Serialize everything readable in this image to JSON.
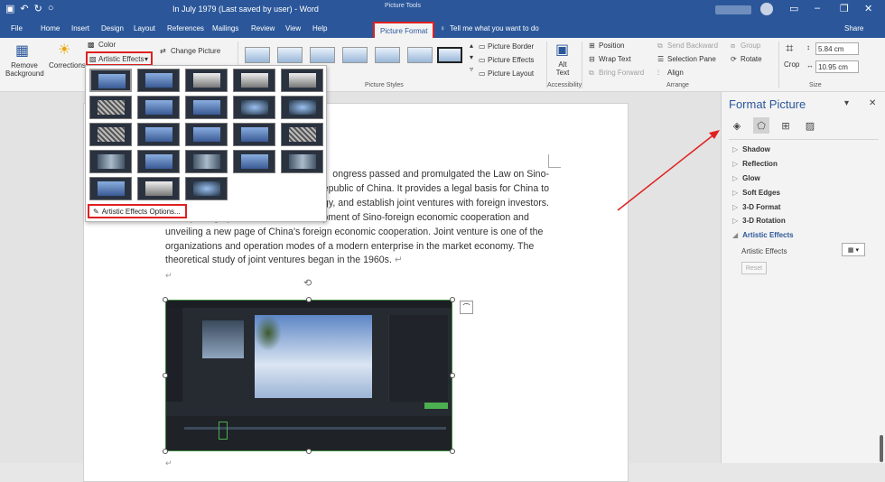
{
  "titlebar": {
    "title": "In July 1979 (Last saved by user)  -  Word",
    "contextual_tab_group": "Picture Tools",
    "icons": [
      "save-icon",
      "undo-icon",
      "redo-icon",
      "autosave-icon",
      "avatar",
      "ribbon-display-icon",
      "minimize-icon",
      "restore-icon",
      "close-icon"
    ]
  },
  "tabs": {
    "items": [
      "File",
      "Home",
      "Insert",
      "Design",
      "Layout",
      "References",
      "Mailings",
      "Review",
      "View",
      "Help"
    ],
    "active": "Picture Format",
    "tell_me": "Tell me what you want to do",
    "share": "Share"
  },
  "ribbon": {
    "adjust": {
      "remove_background": "Remove Background",
      "corrections": "Corrections",
      "color": "Color",
      "artistic_effects": "Artistic Effects",
      "change_picture": "Change Picture"
    },
    "picture_styles": {
      "label": "Picture Styles",
      "border": "Picture Border",
      "effects": "Picture Effects",
      "layout": "Picture Layout"
    },
    "accessibility": {
      "alt_text": "Alt Text",
      "label": "Accessibility"
    },
    "arrange": {
      "position": "Position",
      "wrap_text": "Wrap Text",
      "bring_forward": "Bring Forward",
      "send_backward": "Send Backward",
      "selection_pane": "Selection Pane",
      "align": "Align",
      "group": "Group",
      "rotate": "Rotate",
      "label": "Arrange"
    },
    "size": {
      "crop": "Crop",
      "height": "5.84 cm",
      "width": "10.95 cm",
      "label": "Size"
    }
  },
  "artistic_effects_menu": {
    "option": "Artistic Effects Options...",
    "cells": 23
  },
  "document": {
    "lines": [
      "ongress passed and promulgated the Law on Sino-",
      "epublic of China. It provides a legal basis for China to",
      "gy, and establish joint ventures with foreign investors.",
      "And opening up a road for the development of Sino-foreign economic cooperation and",
      "unveiling a new page of China's foreign economic cooperation. Joint venture is one of the",
      "organizations and operation modes of a modern enterprise in the market economy. The",
      "theoretical study of joint ventures began in the 1960s."
    ],
    "paragraph_mark": "↵"
  },
  "format_pane": {
    "title": "Format Picture",
    "sections": [
      "Shadow",
      "Reflection",
      "Glow",
      "Soft Edges",
      "3-D Format",
      "3-D Rotation"
    ],
    "open_section": "Artistic Effects",
    "field_label": "Artistic Effects",
    "reset": "Reset",
    "tab_icons": [
      "fill-line-icon",
      "effects-icon",
      "layout-properties-icon",
      "picture-icon"
    ]
  },
  "colors": {
    "word_blue": "#2b579a",
    "annotation_red": "#e02020"
  }
}
